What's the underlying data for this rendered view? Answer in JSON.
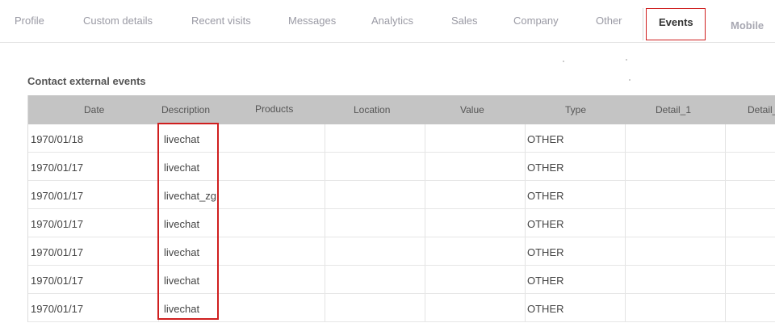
{
  "tabs": [
    {
      "label": "Profile"
    },
    {
      "label": "Custom details"
    },
    {
      "label": "Recent visits"
    },
    {
      "label": "Messages"
    },
    {
      "label": "Analytics"
    },
    {
      "label": "Sales"
    },
    {
      "label": "Company"
    },
    {
      "label": "Other"
    },
    {
      "label": "Events",
      "active": true
    },
    {
      "label": "Mobile"
    }
  ],
  "section": {
    "title": "Contact external events"
  },
  "table": {
    "columns": [
      "Date",
      "Description",
      "Products",
      "Location",
      "Value",
      "Type",
      "Detail_1",
      "Detail_"
    ],
    "rows": [
      {
        "date": "1970/01/18",
        "description": "livechat",
        "products": "",
        "location": "",
        "value": "",
        "type": "OTHER",
        "detail_1": "",
        "detail_2": ""
      },
      {
        "date": "1970/01/17",
        "description": "livechat",
        "products": "",
        "location": "",
        "value": "",
        "type": "OTHER",
        "detail_1": "",
        "detail_2": ""
      },
      {
        "date": "1970/01/17",
        "description": "livechat_zg",
        "products": "",
        "location": "",
        "value": "",
        "type": "OTHER",
        "detail_1": "",
        "detail_2": ""
      },
      {
        "date": "1970/01/17",
        "description": "livechat",
        "products": "",
        "location": "",
        "value": "",
        "type": "OTHER",
        "detail_1": "",
        "detail_2": ""
      },
      {
        "date": "1970/01/17",
        "description": "livechat",
        "products": "",
        "location": "",
        "value": "",
        "type": "OTHER",
        "detail_1": "",
        "detail_2": ""
      },
      {
        "date": "1970/01/17",
        "description": "livechat",
        "products": "",
        "location": "",
        "value": "",
        "type": "OTHER",
        "detail_1": "",
        "detail_2": ""
      },
      {
        "date": "1970/01/17",
        "description": "livechat",
        "products": "",
        "location": "",
        "value": "",
        "type": "OTHER",
        "detail_1": "",
        "detail_2": ""
      }
    ]
  },
  "colors": {
    "accent": "#cf1f1f",
    "header_bg": "#c4c4c4"
  }
}
